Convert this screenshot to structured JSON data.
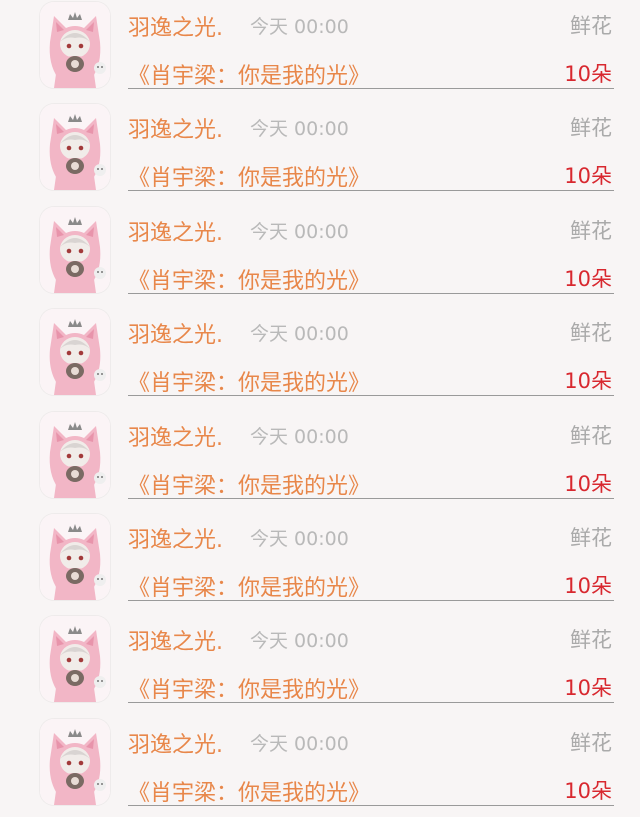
{
  "rows": [
    {
      "user": "羽逸之光.",
      "time": "今天 00:00",
      "gift_type": "鲜花",
      "story": "《肖宇梁：你是我的光》",
      "count": "10朵"
    },
    {
      "user": "羽逸之光.",
      "time": "今天 00:00",
      "gift_type": "鲜花",
      "story": "《肖宇梁：你是我的光》",
      "count": "10朵"
    },
    {
      "user": "羽逸之光.",
      "time": "今天 00:00",
      "gift_type": "鲜花",
      "story": "《肖宇梁：你是我的光》",
      "count": "10朵"
    },
    {
      "user": "羽逸之光.",
      "time": "今天 00:00",
      "gift_type": "鲜花",
      "story": "《肖宇梁：你是我的光》",
      "count": "10朵"
    },
    {
      "user": "羽逸之光.",
      "time": "今天 00:00",
      "gift_type": "鲜花",
      "story": "《肖宇梁：你是我的光》",
      "count": "10朵"
    },
    {
      "user": "羽逸之光.",
      "time": "今天 00:00",
      "gift_type": "鲜花",
      "story": "《肖宇梁：你是我的光》",
      "count": "10朵"
    },
    {
      "user": "羽逸之光.",
      "time": "今天 00:00",
      "gift_type": "鲜花",
      "story": "《肖宇梁：你是我的光》",
      "count": "10朵"
    },
    {
      "user": "羽逸之光.",
      "time": "今天 00:00",
      "gift_type": "鲜花",
      "story": "《肖宇梁：你是我的光》",
      "count": "10朵"
    }
  ],
  "colors": {
    "name": "#e8874a",
    "story": "#e8874a",
    "time": "#b9b9b9",
    "gift_type": "#aaaaaa",
    "count": "#d8282f",
    "divider": "#9a9a9a",
    "background": "#f8f5f5"
  }
}
